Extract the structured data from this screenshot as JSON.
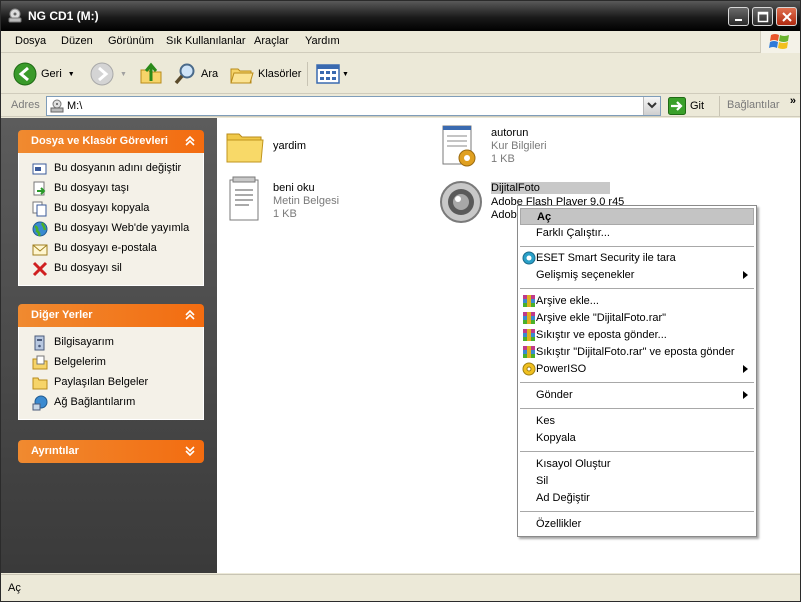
{
  "window": {
    "title": "NG CD1 (M:)"
  },
  "menu": [
    "Dosya",
    "Düzen",
    "Görünüm",
    "Sık Kullanılanlar",
    "Araçlar",
    "Yardım"
  ],
  "toolbar": {
    "back_label": "Geri",
    "search_label": "Ara",
    "folders_label": "Klasörler"
  },
  "address": {
    "label": "Adres",
    "value": "M:\\",
    "go_label": "Git",
    "links_label": "Bağlantılar"
  },
  "tasks_panel": {
    "title": "Dosya ve Klasör Görevleri",
    "items": [
      {
        "label": "Bu dosyanın adını değiştir",
        "icon": "rename-icon"
      },
      {
        "label": "Bu dosyayı taşı",
        "icon": "move-icon"
      },
      {
        "label": "Bu dosyayı kopyala",
        "icon": "copy-icon"
      },
      {
        "label": "Bu dosyayı Web'de yayımla",
        "icon": "globe-icon"
      },
      {
        "label": "Bu dosyayı e-postala",
        "icon": "email-icon"
      },
      {
        "label": "Bu dosyayı sil",
        "icon": "delete-icon"
      }
    ]
  },
  "places_panel": {
    "title": "Diğer Yerler",
    "items": [
      {
        "label": "Bilgisayarım",
        "icon": "computer-icon"
      },
      {
        "label": "Belgelerim",
        "icon": "documents-icon"
      },
      {
        "label": "Paylaşılan Belgeler",
        "icon": "folder-icon"
      },
      {
        "label": "Ağ Bağlantılarım",
        "icon": "network-icon"
      }
    ]
  },
  "details_panel": {
    "title": "Ayrıntılar"
  },
  "files": [
    {
      "name": "yardim",
      "type": "",
      "size": ""
    },
    {
      "name": "autorun",
      "type": "Kur Bilgileri",
      "size": "1 KB"
    },
    {
      "name": "beni oku",
      "type": "Metin Belgesi",
      "size": "1 KB"
    },
    {
      "name": "DijitalFoto",
      "type": "Adobe Flash Player 9.0 r45",
      "size": "Adob"
    }
  ],
  "context_menu": {
    "open": "Aç",
    "run_as": "Farklı Çalıştır...",
    "eset": "ESET Smart Security ile tara",
    "advanced": "Gelişmiş seçenekler",
    "add_archive": "Arşive ekle...",
    "add_archive_named": "Arşive ekle \"DijitalFoto.rar\"",
    "compress_email": "Sıkıştır ve eposta gönder...",
    "compress_named_email": "Sıkıştır \"DijitalFoto.rar\" ve eposta gönder",
    "poweriso": "PowerISO",
    "send_to": "Gönder",
    "cut": "Kes",
    "copy": "Kopyala",
    "create_shortcut": "Kısayol Oluştur",
    "delete": "Sil",
    "rename": "Ad Değiştir",
    "properties": "Özellikler"
  },
  "status": {
    "text": "Aç"
  },
  "colors": {
    "accent": "#f36c10",
    "panel_bg": "#4a4a4a",
    "titlebar": "#1a1a1a"
  }
}
